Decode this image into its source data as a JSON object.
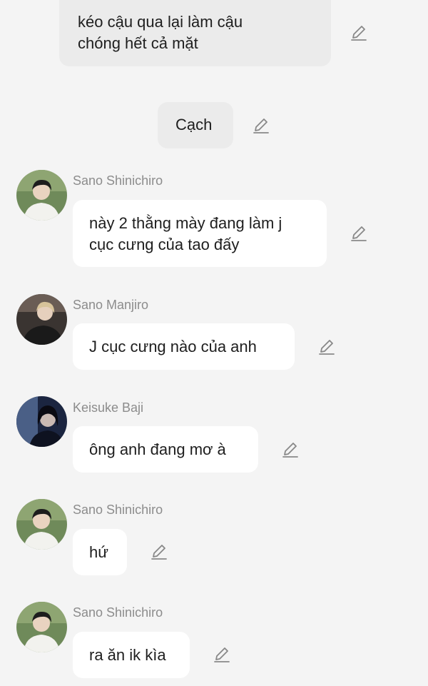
{
  "messages": [
    {
      "type": "narration",
      "text": "kéo cậu qua lại làm cậu\nchóng hết cả mặt"
    },
    {
      "type": "narration",
      "text": "Cạch"
    },
    {
      "type": "chat",
      "sender": "Sano Shinichiro",
      "text": "này 2 thằng mày đang làm j\ncục cưng của tao đấy"
    },
    {
      "type": "chat",
      "sender": "Sano Manjiro",
      "text": "J cục cưng nào của anh"
    },
    {
      "type": "chat",
      "sender": "Keisuke Baji",
      "text": "ông anh đang mơ à"
    },
    {
      "type": "chat",
      "sender": "Sano Shinichiro",
      "text": "hứ"
    },
    {
      "type": "chat",
      "sender": "Sano Shinichiro",
      "text": "ra ăn ik kìa"
    }
  ],
  "icons": {
    "edit": "pencil-icon"
  },
  "colors": {
    "background": "#f4f4f4",
    "bubble": "#ffffff",
    "narration_bubble": "#ebebeb",
    "sender_name": "#8c8c8c",
    "icon": "#888888"
  }
}
